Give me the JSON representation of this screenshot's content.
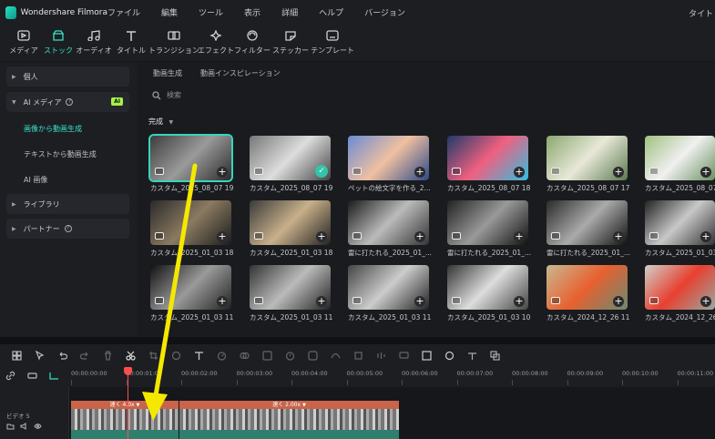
{
  "app": {
    "title": "Wondershare Filmora",
    "right_label": "タイト"
  },
  "menu": [
    "ファイル",
    "編集",
    "ツール",
    "表示",
    "詳細",
    "ヘルプ",
    "バージョン"
  ],
  "toolbar": [
    {
      "label": "メディア",
      "icon": "media-icon"
    },
    {
      "label": "ストック",
      "icon": "stock-icon",
      "active": true
    },
    {
      "label": "オーディオ",
      "icon": "music-note-icon"
    },
    {
      "label": "タイトル",
      "icon": "title-t-icon"
    },
    {
      "label": "トランジション",
      "icon": "transition-icon"
    },
    {
      "label": "エフェクト",
      "icon": "effect-sparkle-icon"
    },
    {
      "label": "フィルター",
      "icon": "filter-icon"
    },
    {
      "label": "ステッカー",
      "icon": "sticker-icon"
    },
    {
      "label": "テンプレート",
      "icon": "template-icon"
    }
  ],
  "sidebar": {
    "personal": "個人",
    "ai_media": "AI メディア",
    "ai_badge": "AI",
    "items": [
      "画像から動画生成",
      "テキストから動画生成",
      "AI 画像"
    ],
    "library": "ライブラリ",
    "partner": "パートナー"
  },
  "content": {
    "tabs": [
      "動画生成",
      "動画インスピレーション"
    ],
    "search_placeholder": "検索",
    "section": "完成",
    "rows": [
      [
        "カスタム_2025_08_07 19...",
        "カスタム_2025_08_07 19...",
        "ペットの絵文字を作る_2...",
        "カスタム_2025_08_07 18...",
        "カスタム_2025_08_07 17...",
        "カスタム_2025_08_07 1"
      ],
      [
        "カスタム_2025_01_03 18...",
        "カスタム_2025_01_03 18...",
        "雷に打たれる_2025_01_...",
        "雷に打たれる_2025_01_...",
        "雷に打たれる_2025_01_...",
        "カスタム_2025_01_03 1"
      ],
      [
        "カスタム_2025_01_03 11...",
        "カスタム_2025_01_03 11...",
        "カスタム_2025_01_03 11...",
        "カスタム_2025_01_03 10...",
        "カスタム_2024_12_26 11...",
        "カスタム_2024_12_26 1"
      ]
    ]
  },
  "timeline": {
    "ticks": [
      "00:00:00:00",
      "00:00:01:00",
      "00:00:02:00",
      "00:00:03:00",
      "00:00:04:00",
      "00:00:05:00",
      "00:00:06:00",
      "00:00:07:00",
      "00:00:08:00",
      "00:00:09:00",
      "00:00:10:00",
      "00:00:11:00"
    ],
    "track_label": "ビデオ 5",
    "clip1_speed": "速く 4.0x",
    "clip2_speed": "速く 2.00x"
  },
  "colors": {
    "accent": "#35e2c6",
    "playhead": "#ff4d4d",
    "annotation_arrow": "#f5e800"
  }
}
